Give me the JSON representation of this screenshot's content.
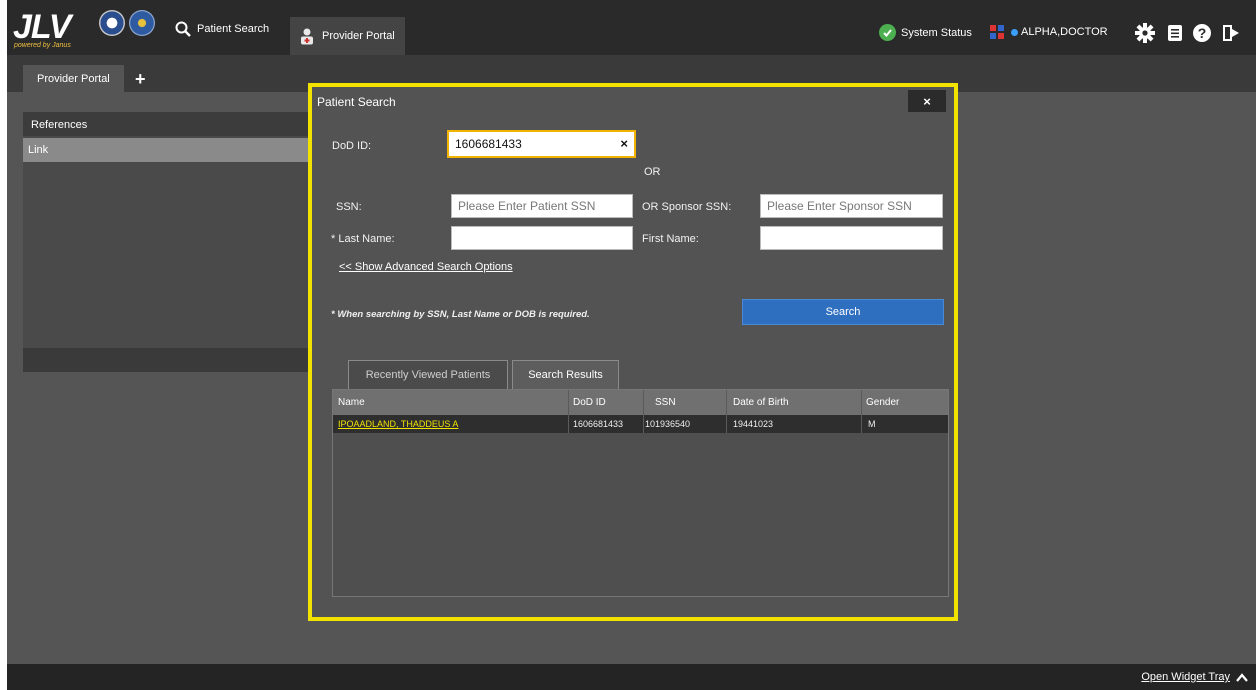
{
  "app": {
    "logo_text": "JLV",
    "logo_subtitle": "powered by Janus"
  },
  "topbar": {
    "patient_search_label": "Patient Search",
    "provider_portal_label": "Provider Portal",
    "system_status_label": "System Status",
    "user_name": "ALPHA,DOCTOR",
    "icons": [
      "search-icon",
      "provider-icon",
      "check-circle-icon",
      "user-switch-icon",
      "gear-icon",
      "list-icon",
      "help-icon",
      "logout-icon"
    ]
  },
  "tabs": {
    "active_label": "Provider Portal",
    "add_label": "+"
  },
  "references": {
    "header": "References",
    "link_label": "Link"
  },
  "modal": {
    "title": "Patient Search",
    "close_label": "×",
    "dod_label": "DoD ID:",
    "dod_value": "1606681433",
    "dod_clear": "×",
    "or_label": "OR",
    "ssn_label": "SSN:",
    "ssn_placeholder": "Please Enter Patient SSN",
    "or_sponsor_label": "OR  Sponsor SSN:",
    "sponsor_placeholder": "Please Enter Sponsor SSN",
    "last_name_label": "* Last Name:",
    "first_name_label": "First Name:",
    "advanced_link": "<< Show Advanced Search Options",
    "hint": "* When searching by SSN, Last Name or DOB is required.",
    "search_button": "Search",
    "tab_recent": "Recently Viewed Patients",
    "tab_results": "Search Results",
    "columns": [
      "Name",
      "DoD ID",
      "SSN",
      "Date of Birth",
      "Gender"
    ],
    "rows": [
      {
        "name": "IPOAADLAND, THADDEUS A",
        "dod_id": "1606681433",
        "ssn": "101936540",
        "dob": "19441023",
        "gender": "M"
      }
    ]
  },
  "bottombar": {
    "widget_tray_label": "Open Widget Tray"
  },
  "colors": {
    "highlight_outline": "#f2e200",
    "search_button": "#2f6fc0",
    "status_ok": "#4caf50"
  }
}
